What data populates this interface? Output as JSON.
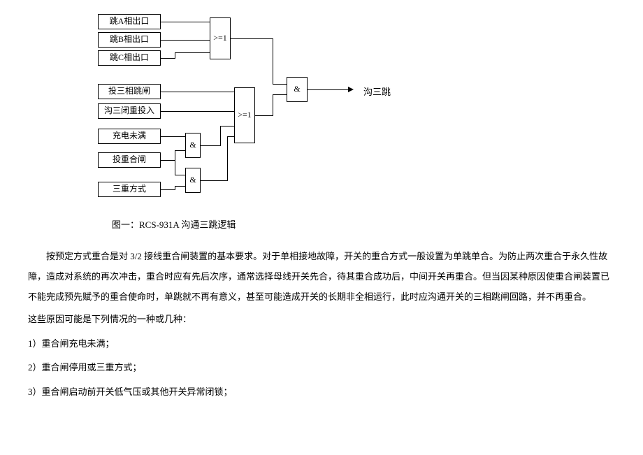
{
  "diagram": {
    "inputs": {
      "a": "跳A相出口",
      "b": "跳B相出口",
      "c": "跳C相出口",
      "d": "投三相跳闸",
      "e": "沟三闭重投入",
      "f": "充电未满",
      "g": "投重合闸",
      "h": "三重方式"
    },
    "gates": {
      "or": ">=1",
      "and": "&"
    },
    "output": "沟三跳"
  },
  "caption": "图一：RCS-931A 沟通三跳逻辑",
  "paragraph": "按预定方式重合是对 3/2 接线重合闸装置的基本要求。对于单相接地故障，开关的重合方式一般设置为单跳单合。为防止两次重合于永久性故障，造成对系统的再次冲击，重合时应有先后次序，通常选择母线开关先合，待其重合成功后，中间开关再重合。但当因某种原因使重合闸装置已不能完成预先赋予的重合使命时，单跳就不再有意义，甚至可能造成开关的长期非全相运行，此时应沟通开关的三相跳闸回路，并不再重合。",
  "list_intro": "这些原因可能是下列情况的一种或几种：",
  "list": {
    "item1": "1）重合闸充电未满；",
    "item2": "2）重合闸停用或三重方式；",
    "item3": "3）重合闸启动前开关低气压或其他开关异常闭锁；"
  }
}
